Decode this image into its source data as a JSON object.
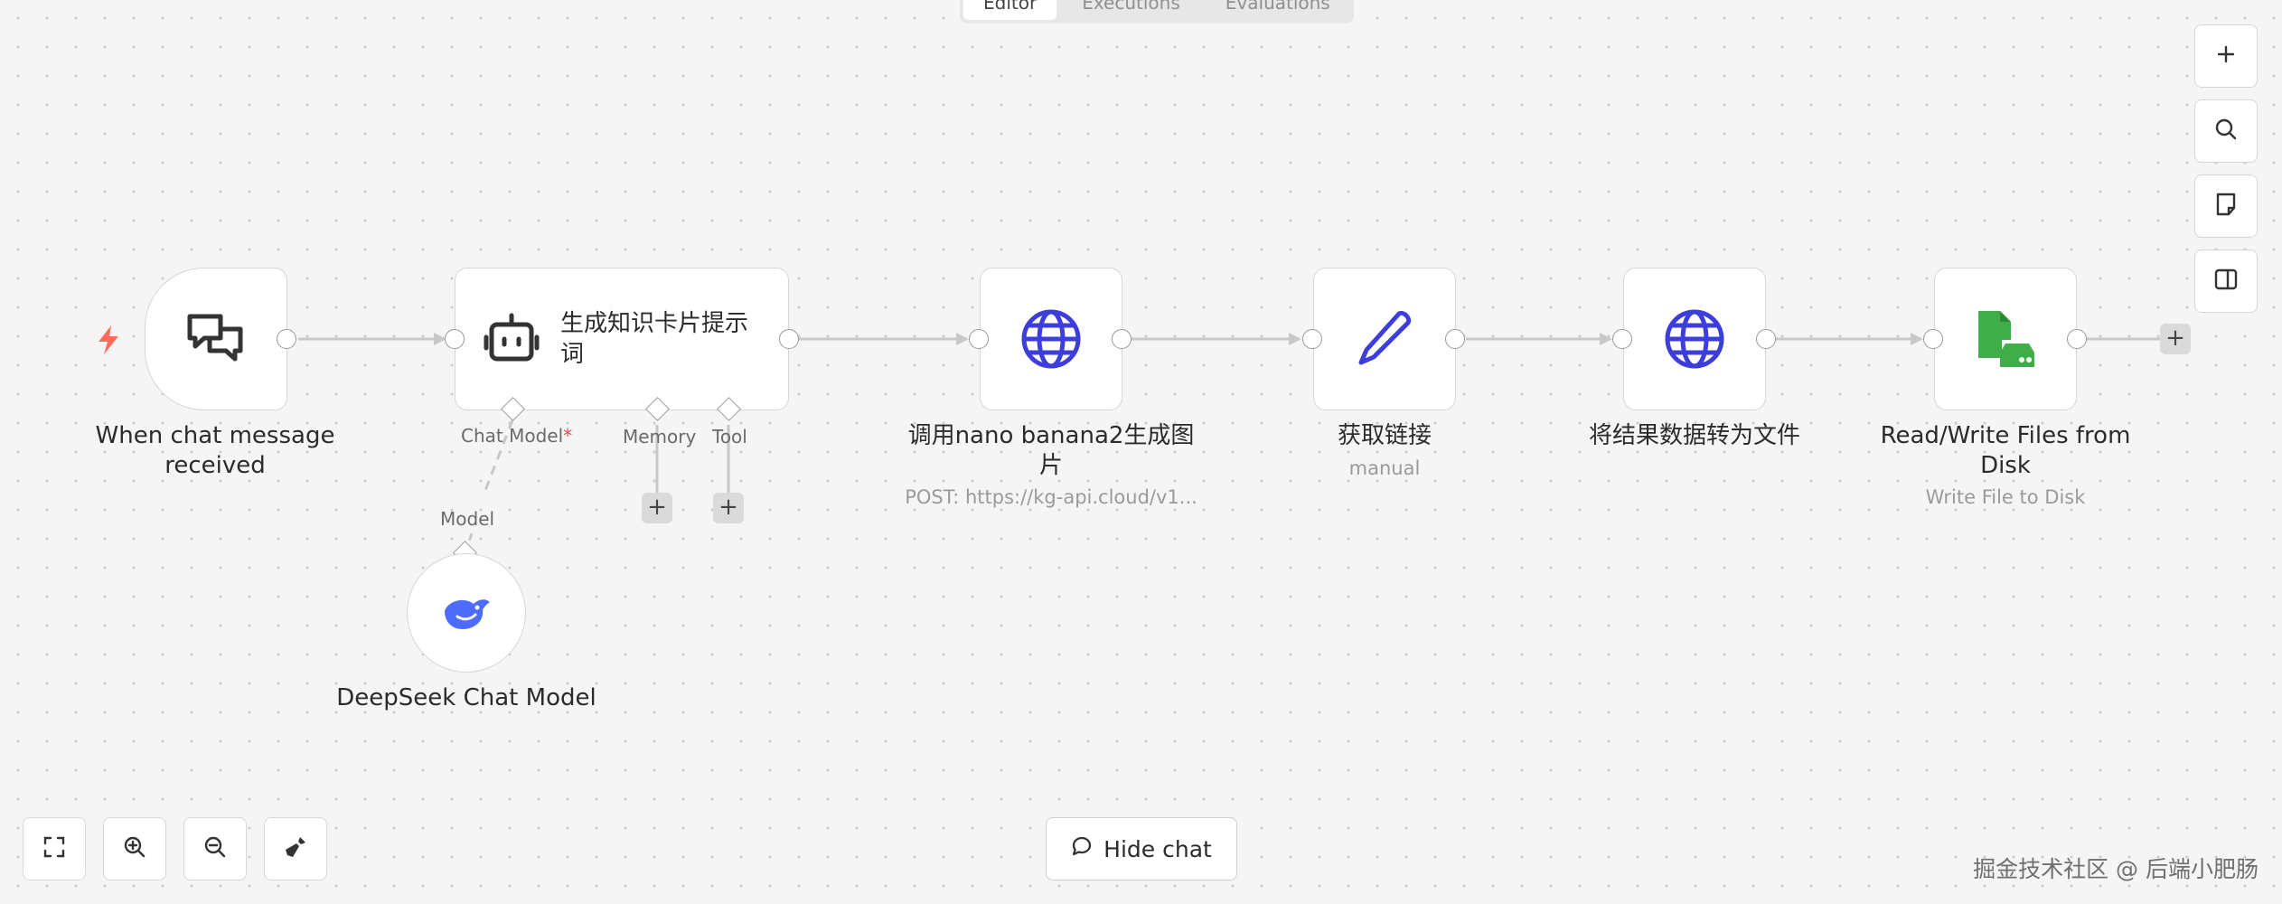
{
  "tabs": [
    {
      "label": "Editor",
      "active": true
    },
    {
      "label": "Executions",
      "active": false
    },
    {
      "label": "Evaluations",
      "active": false
    }
  ],
  "nodes": {
    "chat_trigger": {
      "title": "When chat message received",
      "icon": "chat-bubbles-icon"
    },
    "agent": {
      "title": "生成知识卡片提示词",
      "icon": "robot-icon",
      "slots": {
        "chat_model": "Chat Model",
        "memory": "Memory",
        "tool": "Tool"
      }
    },
    "deepseek": {
      "title": "DeepSeek Chat Model",
      "slot_label": "Model",
      "icon": "deepseek-whale-icon",
      "icon_color": "#4D6BFE"
    },
    "http1": {
      "title": "调用nano banana2生成图片",
      "subtitle": "POST: https://kg-api.cloud/v1...",
      "icon": "globe-icon"
    },
    "set_link": {
      "title": "获取链接",
      "subtitle": "manual",
      "icon": "pen-icon"
    },
    "http2": {
      "title": "将结果数据转为文件",
      "icon": "globe-icon"
    },
    "rw_files": {
      "title": "Read/Write Files from Disk",
      "subtitle": "Write File to Disk",
      "icon": "file-disk-icon",
      "icon_color": "#3FAE49"
    }
  },
  "colors": {
    "accent_icon": "#3D3DDC",
    "trigger_bolt": "#FF6D5A",
    "edge": "#c8c8c8"
  },
  "controls": {
    "right": [
      "zoom-plus-icon",
      "search-icon",
      "sticky-note-icon",
      "panel-icon"
    ],
    "bottom": [
      "fit-view-icon",
      "zoom-in-icon",
      "zoom-out-icon",
      "tidy-up-icon"
    ]
  },
  "hide_chat_label": "Hide chat",
  "watermark": "掘金技术社区 @ 后端小肥肠"
}
